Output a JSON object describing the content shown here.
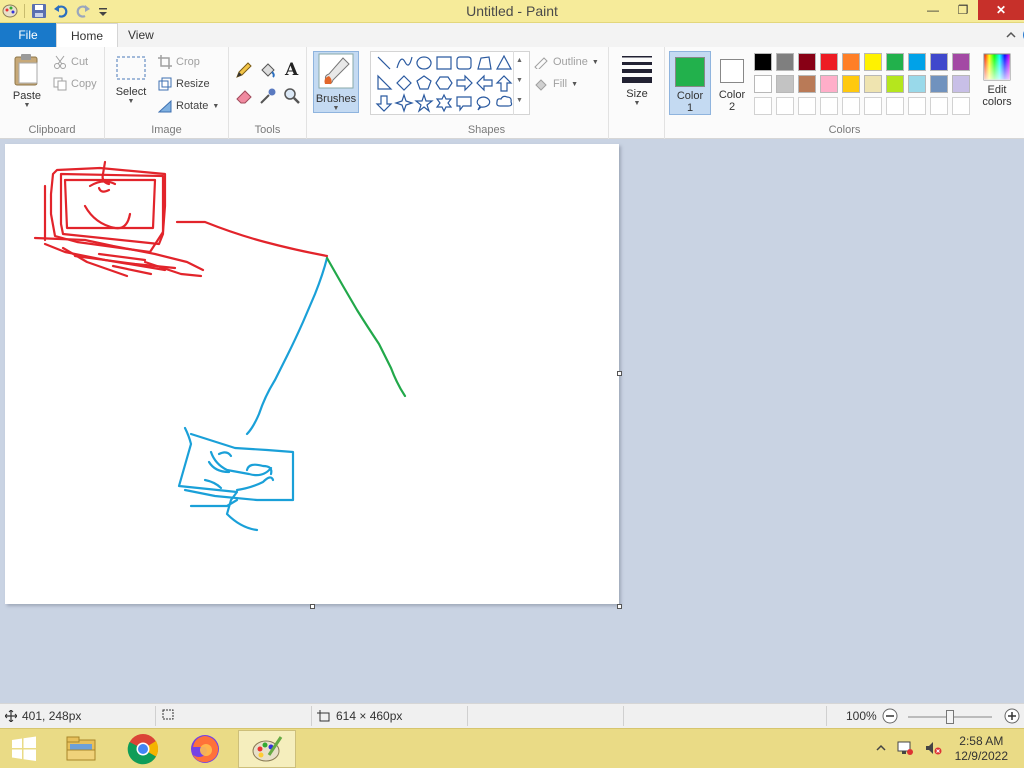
{
  "window": {
    "title": "Untitled - Paint",
    "minimize_glyph": "—",
    "restore_glyph": "❐",
    "close_glyph": "✕"
  },
  "tabs": {
    "file": "File",
    "home": "Home",
    "view": "View"
  },
  "clipboard": {
    "paste": "Paste",
    "cut": "Cut",
    "copy": "Copy",
    "label": "Clipboard"
  },
  "image": {
    "select": "Select",
    "crop": "Crop",
    "resize": "Resize",
    "rotate": "Rotate",
    "label": "Image"
  },
  "tools": {
    "label": "Tools"
  },
  "brushes": {
    "label": "Brushes"
  },
  "shapes": {
    "outline": "Outline",
    "fill": "Fill",
    "label": "Shapes"
  },
  "size": {
    "label": "Size"
  },
  "colors": {
    "color1_line1": "Color",
    "color1_line2": "1",
    "color2_line1": "Color",
    "color2_line2": "2",
    "edit_line1": "Edit",
    "edit_line2": "colors",
    "label": "Colors",
    "color1_value": "#22b14c",
    "color2_value": "#ffffff",
    "palette_row1": [
      "#000000",
      "#7f7f7f",
      "#880015",
      "#ed1c24",
      "#ff7f27",
      "#fff200",
      "#22b14c",
      "#00a2e8",
      "#3f48cc",
      "#a349a4"
    ],
    "palette_row2": [
      "#ffffff",
      "#c3c3c3",
      "#b97a57",
      "#ffaec9",
      "#ffc90e",
      "#efe4b0",
      "#b5e61d",
      "#99d9ea",
      "#7092be",
      "#c8bfe7"
    ]
  },
  "drawing": {
    "stroke_red": "#e2242b",
    "stroke_blue": "#1aa0d8",
    "stroke_green": "#22a84a"
  },
  "status": {
    "cursor_pos": "401, 248px",
    "canvas_size": "614 × 460px",
    "zoom": "100%",
    "zoom_level": 1.0
  },
  "taskbar": {
    "time": "2:58 AM",
    "date": "12/9/2022"
  }
}
